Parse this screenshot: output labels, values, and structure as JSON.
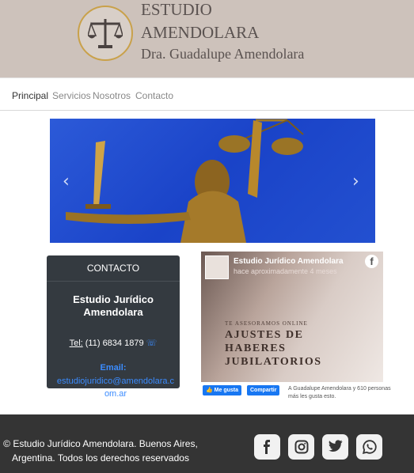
{
  "header": {
    "title_line1": "ESTUDIO",
    "title_line2": "AMENDOLARA",
    "subtitle": "Dra. Guadalupe Amendolara"
  },
  "nav": {
    "items": [
      {
        "label": "Principal",
        "active": true
      },
      {
        "label": "Servicios",
        "active": false
      },
      {
        "label": "Nosotros",
        "active": false
      },
      {
        "label": "Contacto",
        "active": false
      }
    ]
  },
  "carousel": {
    "prev_icon": "chevron-left-icon",
    "next_icon": "chevron-right-icon"
  },
  "contact": {
    "heading": "CONTACTO",
    "name": "Estudio Jurídico Amendolara",
    "tel_label": "Tel:",
    "tel_value": "(11) 6834 1879",
    "email_label": "Email:",
    "email_value": "estudiojuridico@amendolara.com.ar"
  },
  "facebook": {
    "page_name": "Estudio Jurídico Amendolara",
    "time": "hace aproximadamente 4 meses",
    "promo_small": "TE ASESORAMOS ONLINE",
    "promo_line1": "AJUSTES DE",
    "promo_line2": "HABERES",
    "promo_line3": "JUBILATORIOS",
    "like_label": "Me gusta",
    "share_label": "Compartir",
    "likes_text": "A Guadalupe Amendolara y 610 personas más les gusta esto."
  },
  "footer": {
    "copyright": "© Estudio Jurídico Amendolara. Buenos Aires, Argentina. Todos los derechos reservados",
    "social": [
      "facebook-icon",
      "instagram-icon",
      "twitter-icon",
      "whatsapp-icon"
    ]
  },
  "colors": {
    "header_bg": "#cdc2bb",
    "card_bg": "#343a40",
    "footer_bg": "#343434",
    "link_blue": "#3b8cff",
    "facebook_blue": "#1877f2"
  }
}
